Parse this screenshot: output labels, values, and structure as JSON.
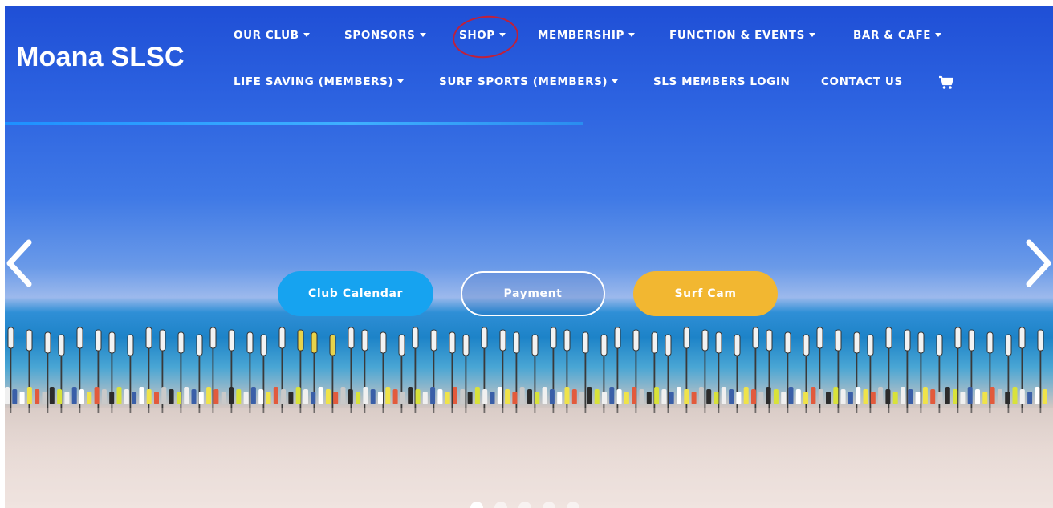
{
  "brand": {
    "logo_text": "Moana SLSC"
  },
  "nav": {
    "row1": [
      {
        "label": "OUR CLUB",
        "dropdown": true
      },
      {
        "label": "SPONSORS",
        "dropdown": true
      },
      {
        "label": "SHOP",
        "dropdown": true
      },
      {
        "label": "MEMBERSHIP",
        "dropdown": true
      },
      {
        "label": "FUNCTION & EVENTS",
        "dropdown": true
      },
      {
        "label": "BAR & CAFE",
        "dropdown": true
      }
    ],
    "row2": [
      {
        "label": "LIFE SAVING (MEMBERS)",
        "dropdown": true
      },
      {
        "label": "SURF SPORTS (MEMBERS)",
        "dropdown": true
      },
      {
        "label": "SLS MEMBERS LOGIN",
        "dropdown": false
      },
      {
        "label": "CONTACT US",
        "dropdown": false
      }
    ],
    "cart_icon": "shopping-cart-icon"
  },
  "slider": {
    "prev_icon": "chevron-left-icon",
    "next_icon": "chevron-right-icon",
    "dot_count": 5,
    "active_dot": 0
  },
  "cta": {
    "calendar_label": "Club Calendar",
    "payment_label": "Payment",
    "surfcam_label": "Surf Cam"
  },
  "colors": {
    "accent_blue": "#16a3f0",
    "accent_yellow": "#f2b731",
    "annotation_red": "#c0203a"
  }
}
